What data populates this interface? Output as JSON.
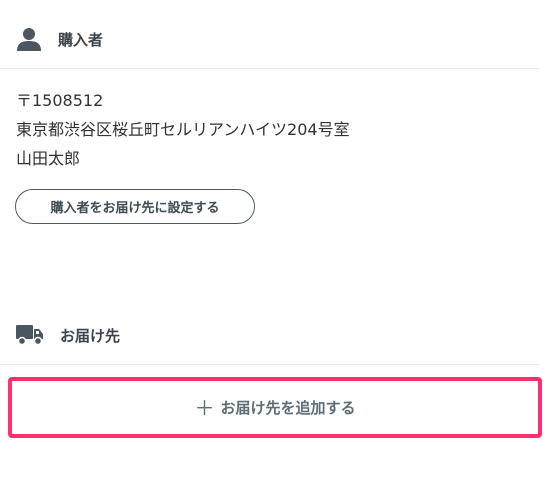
{
  "buyer": {
    "icon": "person-icon",
    "title": "購入者",
    "postal_code": "〒1508512",
    "address": "東京都渋谷区桜丘町セルリアンハイツ204号室",
    "name": "山田太郎",
    "set_as_delivery_label": "購入者をお届け先に設定する"
  },
  "delivery": {
    "icon": "truck-icon",
    "title": "お届け先",
    "add_icon": "plus-icon",
    "add_label": "お届け先を追加する"
  },
  "colors": {
    "highlight_border": "#ff2e6c",
    "icon": "#4a5660",
    "text": "#2e3338"
  }
}
